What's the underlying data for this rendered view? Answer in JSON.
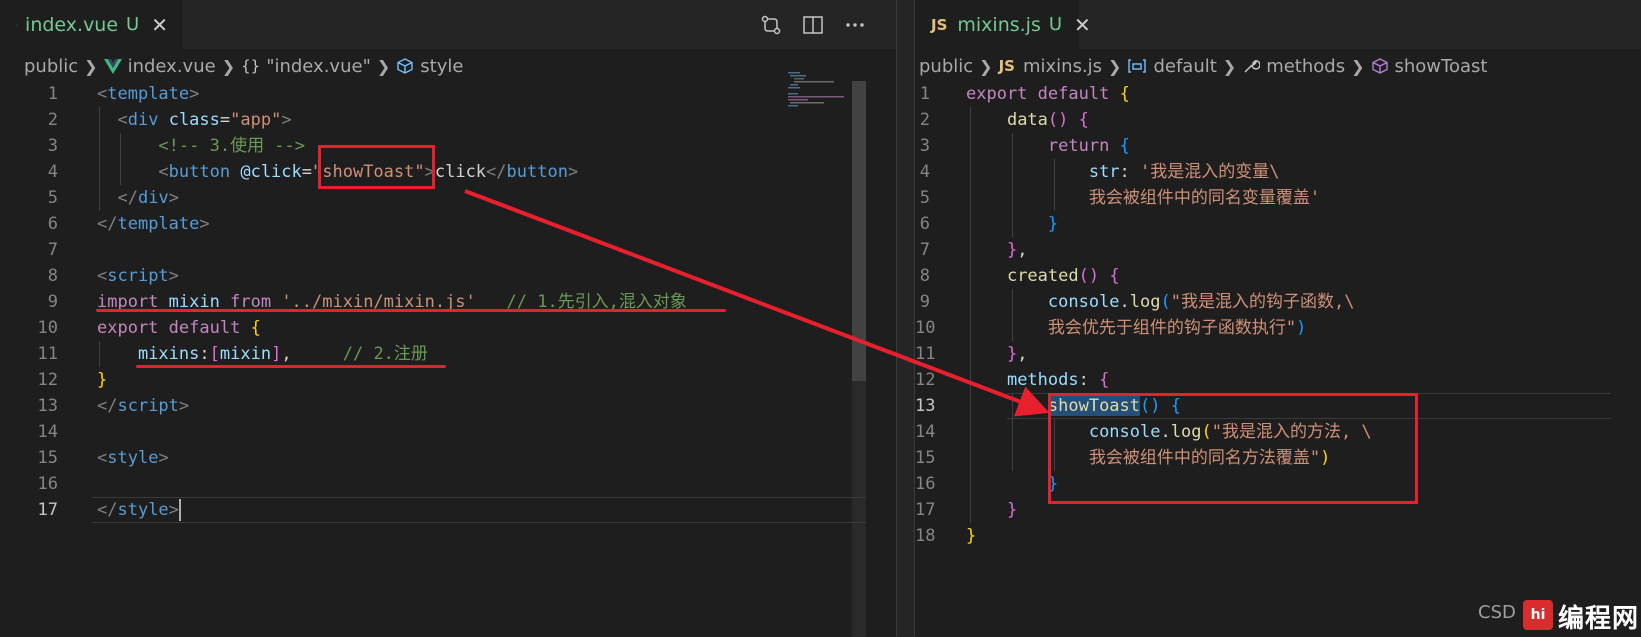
{
  "left": {
    "tab": {
      "name": "index.vue",
      "status": "U",
      "close": "✕"
    },
    "actions": [
      "compare-changes-icon",
      "split-editor-icon",
      "more-actions-icon"
    ],
    "breadcrumb": [
      "public",
      "index.vue",
      "\"index.vue\"",
      "style"
    ],
    "lines": [
      {
        "n": "1",
        "tokens": [
          [
            "t-punc",
            "<"
          ],
          [
            "t-tag",
            "template"
          ],
          [
            "t-punc",
            ">"
          ]
        ]
      },
      {
        "n": "2",
        "tokens": [
          [
            "t-txt",
            "  "
          ],
          [
            "t-punc",
            "<"
          ],
          [
            "t-tag",
            "div"
          ],
          [
            "t-txt",
            " "
          ],
          [
            "t-attr",
            "class"
          ],
          [
            "t-txt",
            "="
          ],
          [
            "t-str",
            "\"app\""
          ],
          [
            "t-punc",
            ">"
          ]
        ]
      },
      {
        "n": "3",
        "tokens": [
          [
            "t-txt",
            "      "
          ],
          [
            "t-comment",
            "<!-- 3.使用 -->"
          ]
        ]
      },
      {
        "n": "4",
        "tokens": [
          [
            "t-txt",
            "      "
          ],
          [
            "t-punc",
            "<"
          ],
          [
            "t-tag",
            "button"
          ],
          [
            "t-txt",
            " "
          ],
          [
            "t-attr",
            "@click"
          ],
          [
            "t-txt",
            "="
          ],
          [
            "t-str",
            "\"showToast\""
          ],
          [
            "t-punc",
            ">"
          ],
          [
            "t-txt",
            "click"
          ],
          [
            "t-punc",
            "</"
          ],
          [
            "t-tag",
            "button"
          ],
          [
            "t-punc",
            ">"
          ]
        ]
      },
      {
        "n": "5",
        "tokens": [
          [
            "t-txt",
            "  "
          ],
          [
            "t-punc",
            "</"
          ],
          [
            "t-tag",
            "div"
          ],
          [
            "t-punc",
            ">"
          ]
        ]
      },
      {
        "n": "6",
        "tokens": [
          [
            "t-punc",
            "</"
          ],
          [
            "t-tag",
            "template"
          ],
          [
            "t-punc",
            ">"
          ]
        ]
      },
      {
        "n": "7",
        "tokens": []
      },
      {
        "n": "8",
        "tokens": [
          [
            "t-punc",
            "<"
          ],
          [
            "t-tag",
            "script"
          ],
          [
            "t-punc",
            ">"
          ]
        ]
      },
      {
        "n": "9",
        "tokens": [
          [
            "t-kw",
            "import"
          ],
          [
            "t-txt",
            " "
          ],
          [
            "t-var",
            "mixin"
          ],
          [
            "t-txt",
            " "
          ],
          [
            "t-kw",
            "from"
          ],
          [
            "t-txt",
            " "
          ],
          [
            "t-str",
            "'../mixin/mixin.js'"
          ],
          [
            "t-txt",
            "   "
          ],
          [
            "t-comment",
            "// 1.先引入,混入对象"
          ]
        ]
      },
      {
        "n": "10",
        "tokens": [
          [
            "t-kw",
            "export"
          ],
          [
            "t-txt",
            " "
          ],
          [
            "t-kw",
            "default"
          ],
          [
            "t-txt",
            " "
          ],
          [
            "t-b1",
            "{"
          ]
        ]
      },
      {
        "n": "11",
        "tokens": [
          [
            "t-txt",
            "    "
          ],
          [
            "t-var",
            "mixins"
          ],
          [
            "t-txt",
            ":"
          ],
          [
            "t-b2",
            "["
          ],
          [
            "t-var",
            "mixin"
          ],
          [
            "t-b2",
            "]"
          ],
          [
            "t-txt",
            ",     "
          ],
          [
            "t-comment",
            "// 2.注册"
          ]
        ]
      },
      {
        "n": "12",
        "tokens": [
          [
            "t-b1",
            "}"
          ]
        ]
      },
      {
        "n": "13",
        "tokens": [
          [
            "t-punc",
            "</"
          ],
          [
            "t-tag",
            "script"
          ],
          [
            "t-punc",
            ">"
          ]
        ]
      },
      {
        "n": "14",
        "tokens": []
      },
      {
        "n": "15",
        "tokens": [
          [
            "t-punc",
            "<"
          ],
          [
            "t-tag",
            "style"
          ],
          [
            "t-punc",
            ">"
          ]
        ]
      },
      {
        "n": "16",
        "tokens": []
      },
      {
        "n": "17",
        "tokens": [
          [
            "t-punc",
            "</"
          ],
          [
            "t-tag",
            "style"
          ],
          [
            "t-punc",
            ">"
          ]
        ]
      }
    ]
  },
  "right": {
    "tab": {
      "badge": "JS",
      "name": "mixins.js",
      "status": "U",
      "close": "✕"
    },
    "breadcrumb": [
      "public",
      "mixins.js",
      "default",
      "methods",
      "showToast"
    ],
    "breadcrumb_badge": "JS",
    "lines": [
      {
        "n": "1",
        "tokens": [
          [
            "t-kw",
            "export"
          ],
          [
            "t-txt",
            " "
          ],
          [
            "t-kw",
            "default"
          ],
          [
            "t-txt",
            " "
          ],
          [
            "t-b1",
            "{"
          ]
        ]
      },
      {
        "n": "2",
        "tokens": [
          [
            "t-txt",
            "    "
          ],
          [
            "t-fn",
            "data"
          ],
          [
            "t-b2",
            "()"
          ],
          [
            "t-txt",
            " "
          ],
          [
            "t-b2",
            "{"
          ]
        ]
      },
      {
        "n": "3",
        "tokens": [
          [
            "t-txt",
            "        "
          ],
          [
            "t-kw",
            "return"
          ],
          [
            "t-txt",
            " "
          ],
          [
            "t-b3",
            "{"
          ]
        ]
      },
      {
        "n": "4",
        "tokens": [
          [
            "t-txt",
            "            "
          ],
          [
            "t-var",
            "str"
          ],
          [
            "t-txt",
            ": "
          ],
          [
            "t-str",
            "'我是混入的变量\\"
          ]
        ]
      },
      {
        "n": "5",
        "tokens": [
          [
            "t-txt",
            "            "
          ],
          [
            "t-str",
            "我会被组件中的同名变量覆盖'"
          ]
        ]
      },
      {
        "n": "6",
        "tokens": [
          [
            "t-txt",
            "        "
          ],
          [
            "t-b3",
            "}"
          ]
        ]
      },
      {
        "n": "7",
        "tokens": [
          [
            "t-txt",
            "    "
          ],
          [
            "t-b2",
            "}"
          ],
          [
            "t-txt",
            ","
          ]
        ]
      },
      {
        "n": "8",
        "tokens": [
          [
            "t-txt",
            "    "
          ],
          [
            "t-fn",
            "created"
          ],
          [
            "t-b2",
            "()"
          ],
          [
            "t-txt",
            " "
          ],
          [
            "t-b2",
            "{"
          ]
        ]
      },
      {
        "n": "9",
        "tokens": [
          [
            "t-txt",
            "        "
          ],
          [
            "t-var",
            "console"
          ],
          [
            "t-txt",
            "."
          ],
          [
            "t-fn",
            "log"
          ],
          [
            "t-b3",
            "("
          ],
          [
            "t-str",
            "\"我是混入的钩子函数,\\"
          ]
        ]
      },
      {
        "n": "10",
        "tokens": [
          [
            "t-txt",
            "        "
          ],
          [
            "t-str",
            "我会优先于组件的钩子函数执行\""
          ],
          [
            "t-b3",
            ")"
          ]
        ]
      },
      {
        "n": "11",
        "tokens": [
          [
            "t-txt",
            "    "
          ],
          [
            "t-b2",
            "}"
          ],
          [
            "t-txt",
            ","
          ]
        ]
      },
      {
        "n": "12",
        "tokens": [
          [
            "t-txt",
            "    "
          ],
          [
            "t-var",
            "methods"
          ],
          [
            "t-txt",
            ": "
          ],
          [
            "t-b2",
            "{"
          ]
        ]
      },
      {
        "n": "13",
        "tokens": [
          [
            "t-txt",
            "        "
          ],
          [
            "t-fn hl-word",
            "showToast"
          ],
          [
            "t-b3",
            "()"
          ],
          [
            "t-txt",
            " "
          ],
          [
            "t-b3",
            "{"
          ]
        ]
      },
      {
        "n": "14",
        "tokens": [
          [
            "t-txt",
            "            "
          ],
          [
            "t-var",
            "console"
          ],
          [
            "t-txt",
            "."
          ],
          [
            "t-fn",
            "log"
          ],
          [
            "t-b1",
            "("
          ],
          [
            "t-str",
            "\"我是混入的方法, \\"
          ]
        ]
      },
      {
        "n": "15",
        "tokens": [
          [
            "t-txt",
            "            "
          ],
          [
            "t-str",
            "我会被组件中的同名方法覆盖\""
          ],
          [
            "t-b1",
            ")"
          ]
        ]
      },
      {
        "n": "16",
        "tokens": [
          [
            "t-txt",
            "        "
          ],
          [
            "t-b3",
            "}"
          ]
        ]
      },
      {
        "n": "17",
        "tokens": [
          [
            "t-txt",
            "    "
          ],
          [
            "t-b2",
            "}"
          ]
        ]
      },
      {
        "n": "18",
        "tokens": [
          [
            "t-b1",
            "}"
          ]
        ]
      }
    ]
  },
  "watermark": {
    "prefix": "CSD",
    "logo": "hi",
    "site": "编程网"
  },
  "colors": {
    "annotation": "#e8202e",
    "modified": "#73c991",
    "background": "#1e1e1e"
  }
}
